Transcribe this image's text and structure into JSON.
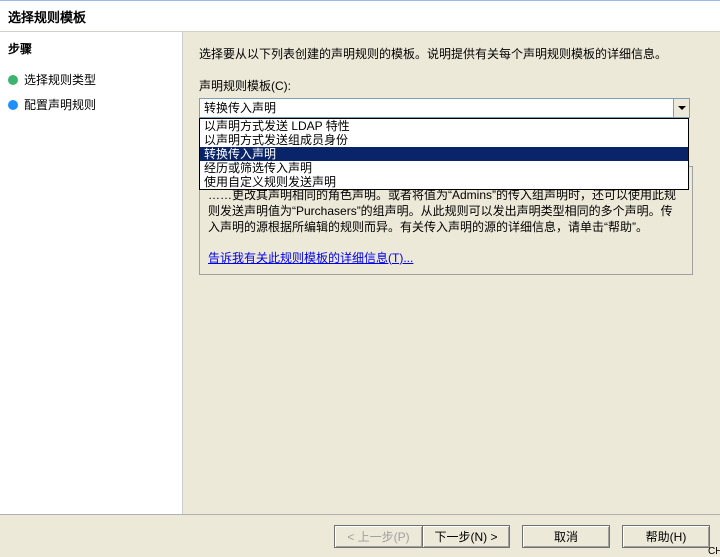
{
  "title": "选择规则模板",
  "sidebar": {
    "heading": "步骤",
    "steps": [
      {
        "label": "选择规则类型",
        "state": "done"
      },
      {
        "label": "配置声明规则",
        "state": "active"
      }
    ]
  },
  "main": {
    "instruction": "选择要从以下列表创建的声明规则的模板。说明提供有关每个声明规则模板的详细信息。",
    "template_label": "声明规则模板(C):",
    "combo_value": "转换传入声明",
    "options": [
      "以声明方式发送 LDAP 特性",
      "以声明方式发送组成员身份",
      "转换传入声明",
      "经历或筛选传入声明",
      "使用自定义规则发送声明"
    ],
    "selected_index": 2,
    "desc_text": "……更改其声明相同的角色声明。或者将值为“Admins”的传入组声明时，还可以使用此规则发送声明值为“Purchasers”的组声明。从此规则可以发出声明类型相同的多个声明。传入声明的源根据所编辑的规则而异。有关传入声明的源的详细信息，请单击“帮助”。",
    "more_link": "告诉我有关此规则模板的详细信息(T)..."
  },
  "footer": {
    "back": "< 上一步(P)",
    "next": "下一步(N) >",
    "cancel": "取消",
    "help": "帮助(H)"
  },
  "ime_badge": "CH"
}
